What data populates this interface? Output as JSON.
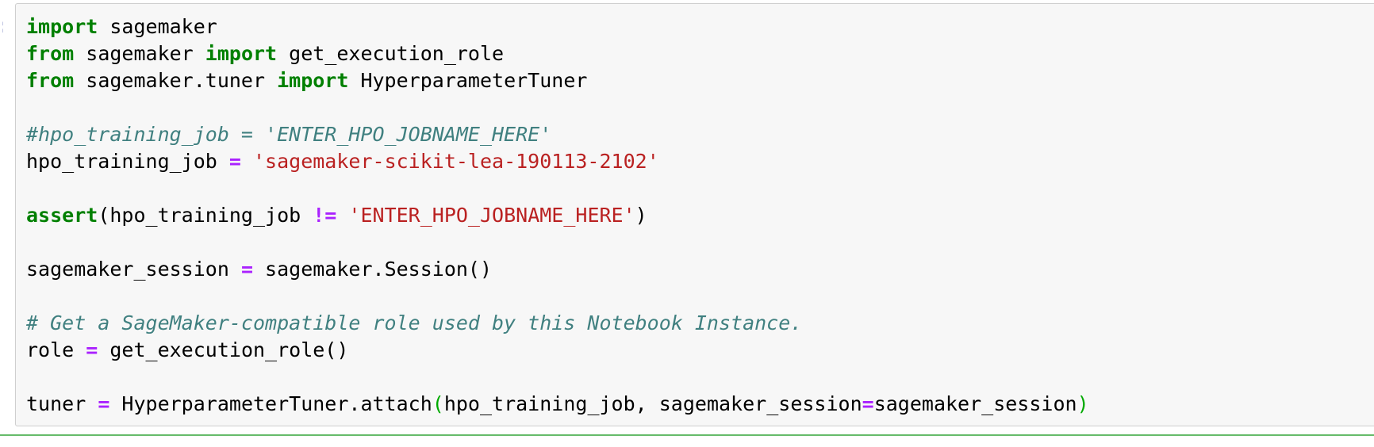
{
  "cell": {
    "prompt": ":",
    "lines": [
      {
        "tokens": [
          {
            "t": "kw",
            "v": "import"
          },
          {
            "t": "txt",
            "v": " sagemaker"
          }
        ]
      },
      {
        "tokens": [
          {
            "t": "kw",
            "v": "from"
          },
          {
            "t": "txt",
            "v": " sagemaker "
          },
          {
            "t": "kw",
            "v": "import"
          },
          {
            "t": "txt",
            "v": " get_execution_role"
          }
        ]
      },
      {
        "tokens": [
          {
            "t": "kw",
            "v": "from"
          },
          {
            "t": "txt",
            "v": " sagemaker.tuner "
          },
          {
            "t": "kw",
            "v": "import"
          },
          {
            "t": "txt",
            "v": " HyperparameterTuner"
          }
        ]
      },
      {
        "tokens": []
      },
      {
        "tokens": [
          {
            "t": "cm",
            "v": "#hpo_training_job = 'ENTER_HPO_JOBNAME_HERE'"
          }
        ]
      },
      {
        "tokens": [
          {
            "t": "txt",
            "v": "hpo_training_job "
          },
          {
            "t": "op",
            "v": "="
          },
          {
            "t": "txt",
            "v": " "
          },
          {
            "t": "str",
            "v": "'sagemaker-scikit-lea-190113-2102'"
          }
        ]
      },
      {
        "tokens": []
      },
      {
        "tokens": [
          {
            "t": "kw",
            "v": "assert"
          },
          {
            "t": "txt",
            "v": "(hpo_training_job "
          },
          {
            "t": "op",
            "v": "!="
          },
          {
            "t": "txt",
            "v": " "
          },
          {
            "t": "str",
            "v": "'ENTER_HPO_JOBNAME_HERE'"
          },
          {
            "t": "txt",
            "v": ")"
          }
        ]
      },
      {
        "tokens": []
      },
      {
        "tokens": [
          {
            "t": "txt",
            "v": "sagemaker_session "
          },
          {
            "t": "op",
            "v": "="
          },
          {
            "t": "txt",
            "v": " sagemaker.Session()"
          }
        ]
      },
      {
        "tokens": []
      },
      {
        "tokens": [
          {
            "t": "cm",
            "v": "# Get a SageMaker-compatible role used by this Notebook Instance."
          }
        ]
      },
      {
        "tokens": [
          {
            "t": "txt",
            "v": "role "
          },
          {
            "t": "op",
            "v": "="
          },
          {
            "t": "txt",
            "v": " get_execution_role()"
          }
        ]
      },
      {
        "tokens": []
      },
      {
        "tokens": [
          {
            "t": "txt",
            "v": "tuner "
          },
          {
            "t": "op",
            "v": "="
          },
          {
            "t": "txt",
            "v": " HyperparameterTuner.attach"
          },
          {
            "t": "match",
            "v": "("
          },
          {
            "t": "txt",
            "v": "hpo_training_job, sagemaker_session"
          },
          {
            "t": "op",
            "v": "="
          },
          {
            "t": "txt",
            "v": "sagemaker_session"
          },
          {
            "t": "match",
            "v": ")"
          }
        ]
      }
    ]
  },
  "colors": {
    "keyword": "#008000",
    "operator": "#aa22ff",
    "string": "#ba2121",
    "comment": "#408080",
    "matched_bracket": "#00aa00",
    "cell_background": "#f7f7f7",
    "cell_border": "#cfcfcf",
    "selected_cell_divider": "#66bb6a"
  }
}
